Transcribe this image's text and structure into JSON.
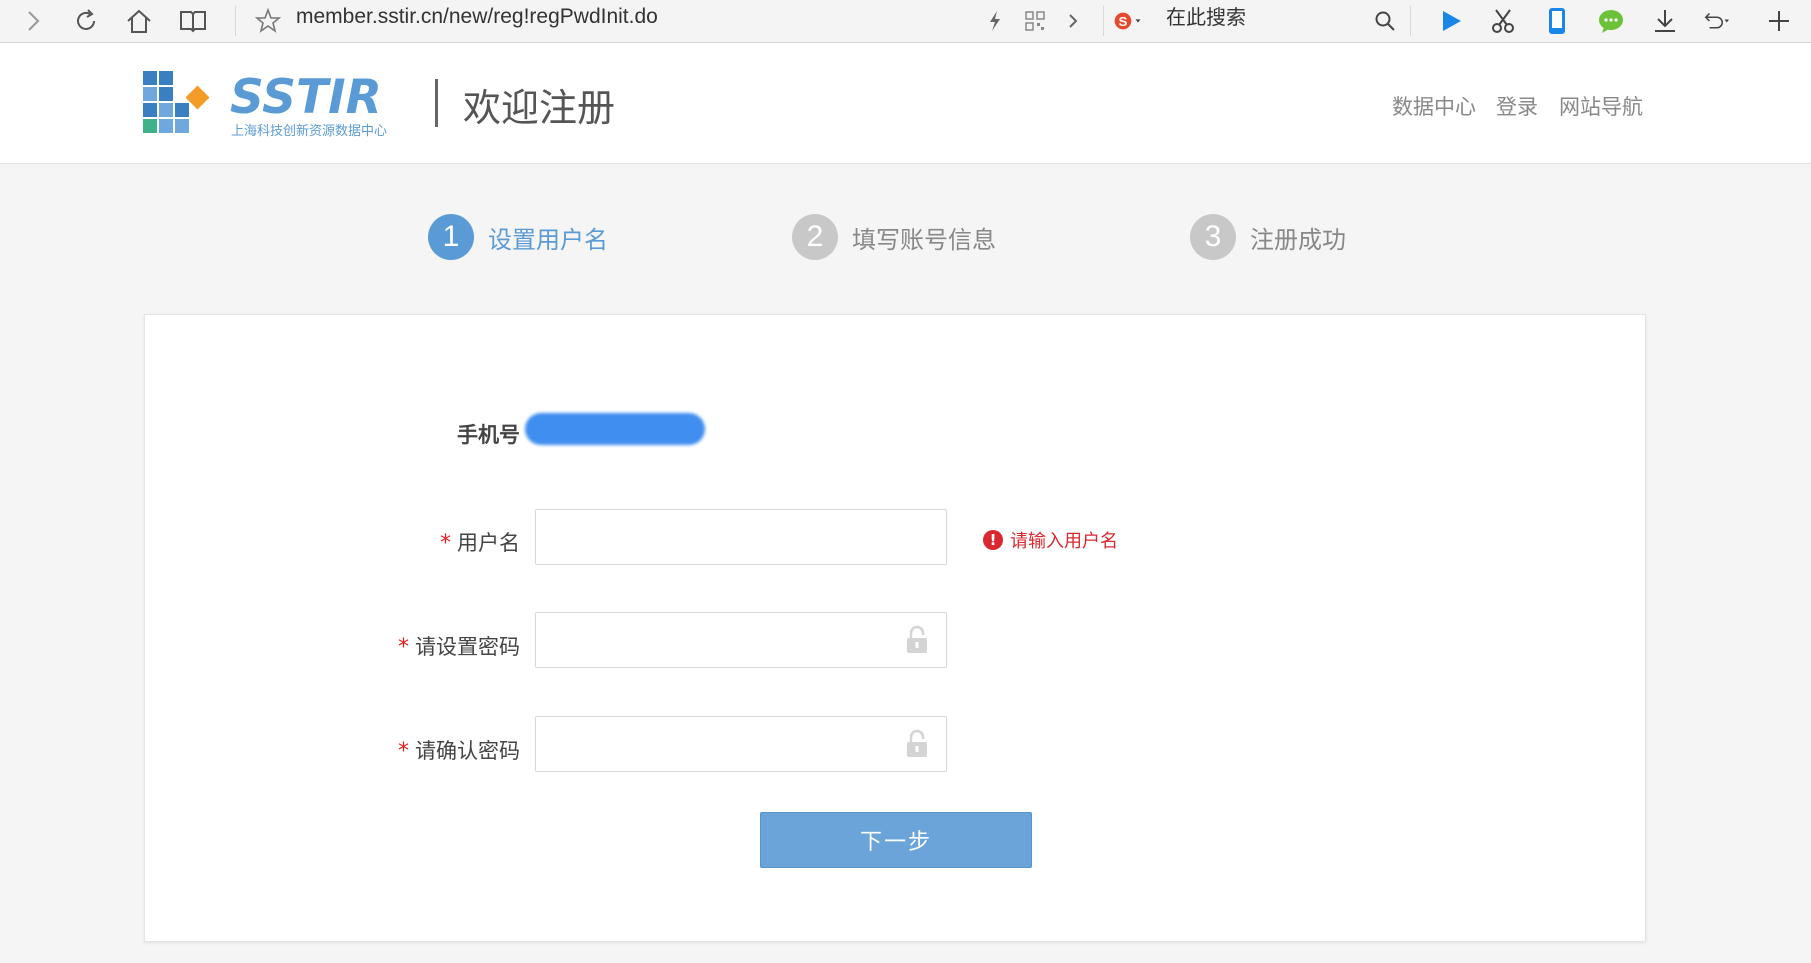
{
  "browser": {
    "url": "member.sstir.cn/new/reg!regPwdInit.do",
    "search_placeholder": "在此搜索"
  },
  "header": {
    "logo_text": "SSTIR",
    "logo_subtitle": "上海科技创新资源数据中心",
    "title": "欢迎注册",
    "nav": [
      {
        "label": "数据中心"
      },
      {
        "label": "登录"
      },
      {
        "label": "网站导航"
      }
    ]
  },
  "steps": [
    {
      "number": "1",
      "label": "设置用户名",
      "active": true
    },
    {
      "number": "2",
      "label": "填写账号信息",
      "active": false
    },
    {
      "number": "3",
      "label": "注册成功",
      "active": false
    }
  ],
  "form": {
    "phone_label": "手机号",
    "required_mark": "*",
    "fields": [
      {
        "label": "用户名",
        "value": "",
        "type": "text"
      },
      {
        "label": "请设置密码",
        "value": "",
        "type": "password"
      },
      {
        "label": "请确认密码",
        "value": "",
        "type": "password"
      }
    ],
    "error_icon_text": "!",
    "username_error": "请输入用户名",
    "next_button": "下一步"
  },
  "colors": {
    "accent": "#5b9bd5",
    "step_inactive": "#c8c8c8",
    "error": "#d9282f",
    "button": "#6ba4d8"
  }
}
